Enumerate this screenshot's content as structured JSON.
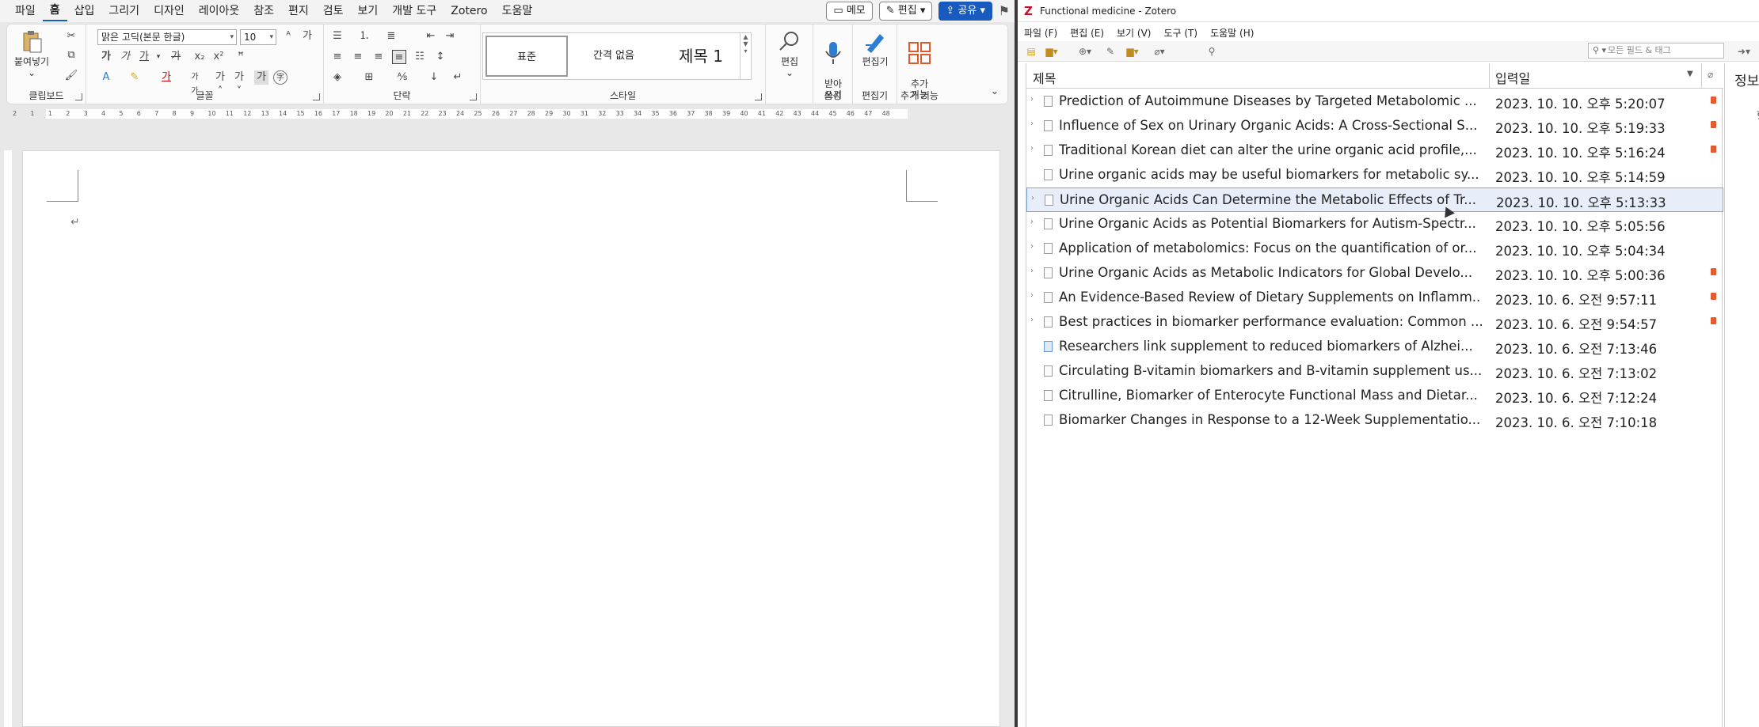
{
  "word": {
    "menu": [
      "파일",
      "홈",
      "삽입",
      "그리기",
      "디자인",
      "레이아웃",
      "참조",
      "편지",
      "검토",
      "보기",
      "개발 도구",
      "Zotero",
      "도움말"
    ],
    "active_menu": "홈",
    "memo_label": "메모",
    "edit_label": "편집",
    "share_label": "공유",
    "clipboard": {
      "paste_label": "붙여넣기",
      "group_label": "클립보드"
    },
    "font": {
      "family": "맑은 고딕(본문 한글)",
      "size": "10",
      "group_label": "글꼴"
    },
    "paragraph": {
      "group_label": "단락"
    },
    "styles": {
      "items": [
        "표준",
        "간격 없음",
        "제목 1"
      ],
      "group_label": "스타일"
    },
    "editing": {
      "label": "편집"
    },
    "voice": {
      "label": "받아\n쓰기",
      "group_label": "음성"
    },
    "editor": {
      "label": "편집기",
      "group_label": "편집기"
    },
    "addins": {
      "label": "추가\n기능",
      "group_label": "추가 기능"
    },
    "ruler_ticks": [
      "2",
      "1",
      "1",
      "2",
      "3",
      "4",
      "5",
      "6",
      "7",
      "8",
      "9",
      "10",
      "11",
      "12",
      "13",
      "14",
      "15",
      "16",
      "17",
      "18",
      "19",
      "20",
      "21",
      "22",
      "23",
      "24",
      "25",
      "26",
      "27",
      "28",
      "29",
      "30",
      "31",
      "32",
      "33",
      "34",
      "35",
      "36",
      "37",
      "38",
      "39",
      "40",
      "41",
      "42",
      "43",
      "44",
      "45",
      "46",
      "47",
      "48"
    ],
    "para_mark": "↵"
  },
  "zotero": {
    "window_title": "Functional medicine - Zotero",
    "menu": [
      "파일 (F)",
      "편집 (E)",
      "보기 (V)",
      "도구 (T)",
      "도움말 (H)"
    ],
    "search_placeholder": "모든 필드 & 태그",
    "columns": {
      "title": "제목",
      "date_added": "입력일"
    },
    "info_label": "정보",
    "info_fragment": "항",
    "items": [
      {
        "title": "Prediction of Autoimmune Diseases by Targeted Metabolomic ...",
        "date": "2023. 10. 10. 오후 5:20:07",
        "expandable": true,
        "pdf": true,
        "type": "doc"
      },
      {
        "title": "Influence of Sex on Urinary Organic Acids: A Cross-Sectional S...",
        "date": "2023. 10. 10. 오후 5:19:33",
        "expandable": true,
        "pdf": true,
        "type": "doc"
      },
      {
        "title": "Traditional Korean diet can alter the urine organic acid profile,...",
        "date": "2023. 10. 10. 오후 5:16:24",
        "expandable": true,
        "pdf": true,
        "type": "doc"
      },
      {
        "title": "Urine organic acids may be useful biomarkers for metabolic sy...",
        "date": "2023. 10. 10. 오후 5:14:59",
        "expandable": false,
        "pdf": false,
        "type": "doc"
      },
      {
        "title": "Urine Organic Acids Can Determine the Metabolic Effects of Tr...",
        "date": "2023. 10. 10. 오후 5:13:33",
        "expandable": true,
        "pdf": false,
        "type": "doc",
        "selected": true
      },
      {
        "title": "Urine Organic Acids as Potential Biomarkers for Autism-Spectr...",
        "date": "2023. 10. 10. 오후 5:05:56",
        "expandable": true,
        "pdf": false,
        "type": "doc"
      },
      {
        "title": "Application of metabolomics: Focus on the quantification of or...",
        "date": "2023. 10. 10. 오후 5:04:34",
        "expandable": true,
        "pdf": false,
        "type": "doc"
      },
      {
        "title": "Urine Organic Acids as Metabolic Indicators for Global Develo...",
        "date": "2023. 10. 10. 오후 5:00:36",
        "expandable": true,
        "pdf": true,
        "type": "doc"
      },
      {
        "title": "An Evidence-Based Review of Dietary Supplements on Inflamm...",
        "date": "2023. 10. 6. 오전 9:57:11",
        "expandable": true,
        "pdf": true,
        "type": "doc"
      },
      {
        "title": "Best practices in biomarker performance evaluation: Common ...",
        "date": "2023. 10. 6. 오전 9:54:57",
        "expandable": true,
        "pdf": true,
        "type": "doc"
      },
      {
        "title": "Researchers link supplement to reduced biomarkers of Alzhei...",
        "date": "2023. 10. 6. 오전 7:13:46",
        "expandable": false,
        "pdf": false,
        "type": "web"
      },
      {
        "title": "Circulating B-vitamin biomarkers and B-vitamin supplement us...",
        "date": "2023. 10. 6. 오전 7:13:02",
        "expandable": false,
        "pdf": false,
        "type": "doc"
      },
      {
        "title": "Citrulline, Biomarker of Enterocyte Functional Mass and Dietar...",
        "date": "2023. 10. 6. 오전 7:12:24",
        "expandable": false,
        "pdf": false,
        "type": "doc"
      },
      {
        "title": "Biomarker Changes in Response to a 12-Week Supplementatio...",
        "date": "2023. 10. 6. 오전 7:10:18",
        "expandable": false,
        "pdf": false,
        "type": "doc"
      }
    ]
  },
  "colors": {
    "accent": "#185abd",
    "selection_bg": "#e7eef9",
    "selection_border": "#7ea7dc",
    "pdf_icon": "#e25c2f",
    "zotero_logo": "#c8102e"
  }
}
